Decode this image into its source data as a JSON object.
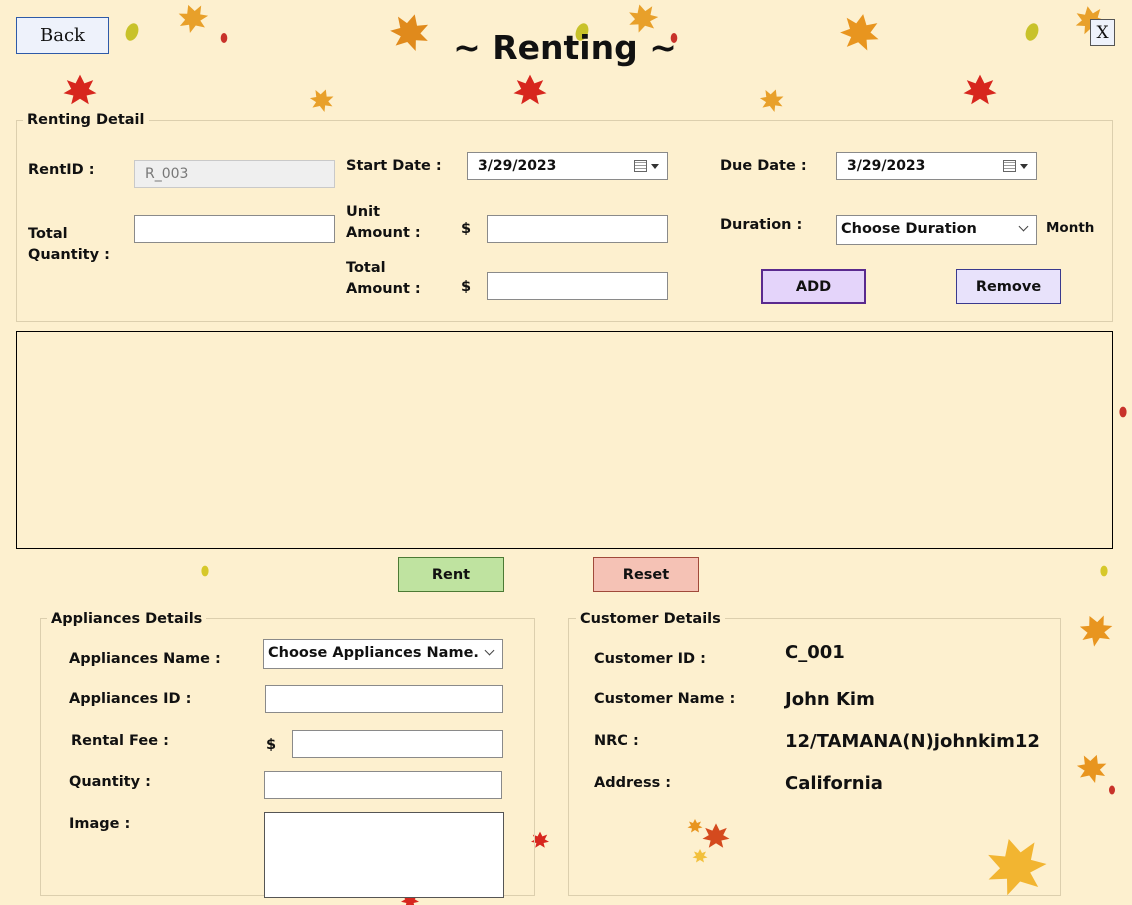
{
  "window": {
    "title": "~ Renting ~",
    "back_label": "Back",
    "close_label": "X"
  },
  "renting_detail": {
    "group_title": "Renting Detail",
    "rent_id_label": "RentID :",
    "rent_id_value": "R_003",
    "total_quantity_label_1": "Total",
    "total_quantity_label_2": "Quantity :",
    "total_quantity_value": "",
    "start_date_label": "Start Date :",
    "start_date_value": "3/29/2023",
    "unit_amount_label_1": "Unit",
    "unit_amount_label_2": "Amount :",
    "unit_amount_currency": "$",
    "unit_amount_value": "",
    "total_amount_label_1": "Total",
    "total_amount_label_2": "Amount :",
    "total_amount_currency": "$",
    "total_amount_value": "",
    "due_date_label": "Due Date :",
    "due_date_value": "3/29/2023",
    "duration_label": "Duration :",
    "duration_value": "Choose Duration",
    "duration_unit": "Month",
    "add_label": "ADD",
    "remove_label": "Remove"
  },
  "actions": {
    "rent_label": "Rent",
    "reset_label": "Reset"
  },
  "appliances": {
    "group_title": "Appliances Details",
    "name_label": "Appliances Name :",
    "name_value": "Choose Appliances Name.",
    "id_label": "Appliances ID :",
    "id_value": "",
    "rental_fee_label": "Rental Fee :",
    "rental_fee_currency": "$",
    "rental_fee_value": "",
    "quantity_label": "Quantity :",
    "quantity_value": "",
    "image_label": "Image :"
  },
  "customer": {
    "group_title": "Customer Details",
    "id_label": "Customer ID :",
    "id_value": "C_001",
    "name_label": "Customer Name :",
    "name_value": "John Kim",
    "nrc_label": "NRC :",
    "nrc_value": "12/TAMANA(N)johnkim12",
    "address_label": "Address :",
    "address_value": "California"
  },
  "colors": {
    "background": "#fdf0cf",
    "add_button": "#e4d4fa",
    "remove_button": "#e8e2fb",
    "rent_button": "#bfe3a0",
    "reset_button": "#f5c2b5",
    "back_button": "#eef2fb"
  }
}
